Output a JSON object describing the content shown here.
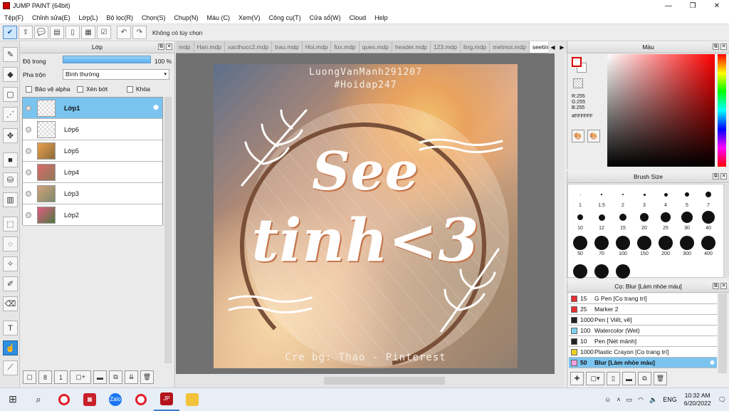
{
  "window": {
    "title": "JUMP PAINT (64bit)"
  },
  "menu": [
    "Tệp(F)",
    "Chỉnh sửa(E)",
    "Lớp(L)",
    "Bộ lọc(R)",
    "Chọn(S)",
    "Chụp(N)",
    "Màu (C)",
    "Xem(V)",
    "Công cụ(T)",
    "Cửa sổ(W)",
    "Cloud",
    "Help"
  ],
  "toolbar": {
    "hint": "Không có tùy chọn"
  },
  "layer_panel": {
    "title": "Lớp",
    "opacity_label": "Độ trong",
    "opacity_value": "100 %",
    "opacity_fraction": 1.0,
    "blend_label": "Pha trộn",
    "blend_value": "Bình thường",
    "protect_alpha": "Bảo vệ alpha",
    "clipping": "Xén bớt",
    "lock": "Khóa",
    "layers": [
      {
        "name": "Lớp1",
        "selected": true
      },
      {
        "name": "Lớp6",
        "selected": false
      },
      {
        "name": "Lớp5",
        "selected": false
      },
      {
        "name": "Lớp4",
        "selected": false
      },
      {
        "name": "Lớp3",
        "selected": false
      },
      {
        "name": "Lớp2",
        "selected": false
      }
    ]
  },
  "tabs": [
    "mdp",
    "Han.mdp",
    "xacthucc2.mdp",
    "trau.mdp",
    "Hoi.mdp",
    "fox.mdp",
    "ques.mdp",
    "header.mdp",
    "123.mdp",
    "ling.mdp",
    "metmoi.mdp",
    "seetinh.mdp"
  ],
  "active_tab": "seetinh.mdp",
  "artwork": {
    "credit_top": "LuongVanManh291207",
    "hashtag": "#Hoidap247",
    "line1": "See",
    "line2": "tinh<3",
    "credit_bottom": "Cre bg: Thao - Pinterest"
  },
  "color_panel": {
    "title": "Màu",
    "r": "R:255",
    "g": "G:255",
    "b": "B:255",
    "hex": "#FFFFFF",
    "hue_color": "#ff0000"
  },
  "brush_size": {
    "title": "Brush Size",
    "sizes": [
      "1",
      "1.5",
      "2",
      "3",
      "4",
      "5",
      "7",
      "10",
      "12",
      "15",
      "20",
      "25",
      "30",
      "40",
      "50",
      "70",
      "100",
      "150",
      "200",
      "300",
      "400"
    ]
  },
  "preset_panel": {
    "title": "Cọ: Blur [Làm nhòe màu]",
    "items": [
      {
        "size": "15",
        "name": "G Pen [Cọ trang trí]",
        "color": "#e53030",
        "selected": false
      },
      {
        "size": "25",
        "name": "Marker 2",
        "color": "#e53030",
        "selected": false
      },
      {
        "size": "1000",
        "name": "Pen [ Viết, vẽ]",
        "color": "#222222",
        "selected": false
      },
      {
        "size": "100",
        "name": "Watercolor (Wet)",
        "color": "#7fd0f0",
        "selected": false
      },
      {
        "size": "10",
        "name": "Pen [Nét mảnh]",
        "color": "#222222",
        "selected": false
      },
      {
        "size": "1000",
        "name": "Plastic Crayon [Cọ trang trí]",
        "color": "#f0d020",
        "selected": false
      },
      {
        "size": "50",
        "name": "Blur [Làm nhòe màu]",
        "color": "#f0a0e0",
        "selected": true
      }
    ]
  },
  "taskbar": {
    "lang": "ENG",
    "time": "10:32 AM",
    "date": "6/20/2022"
  }
}
